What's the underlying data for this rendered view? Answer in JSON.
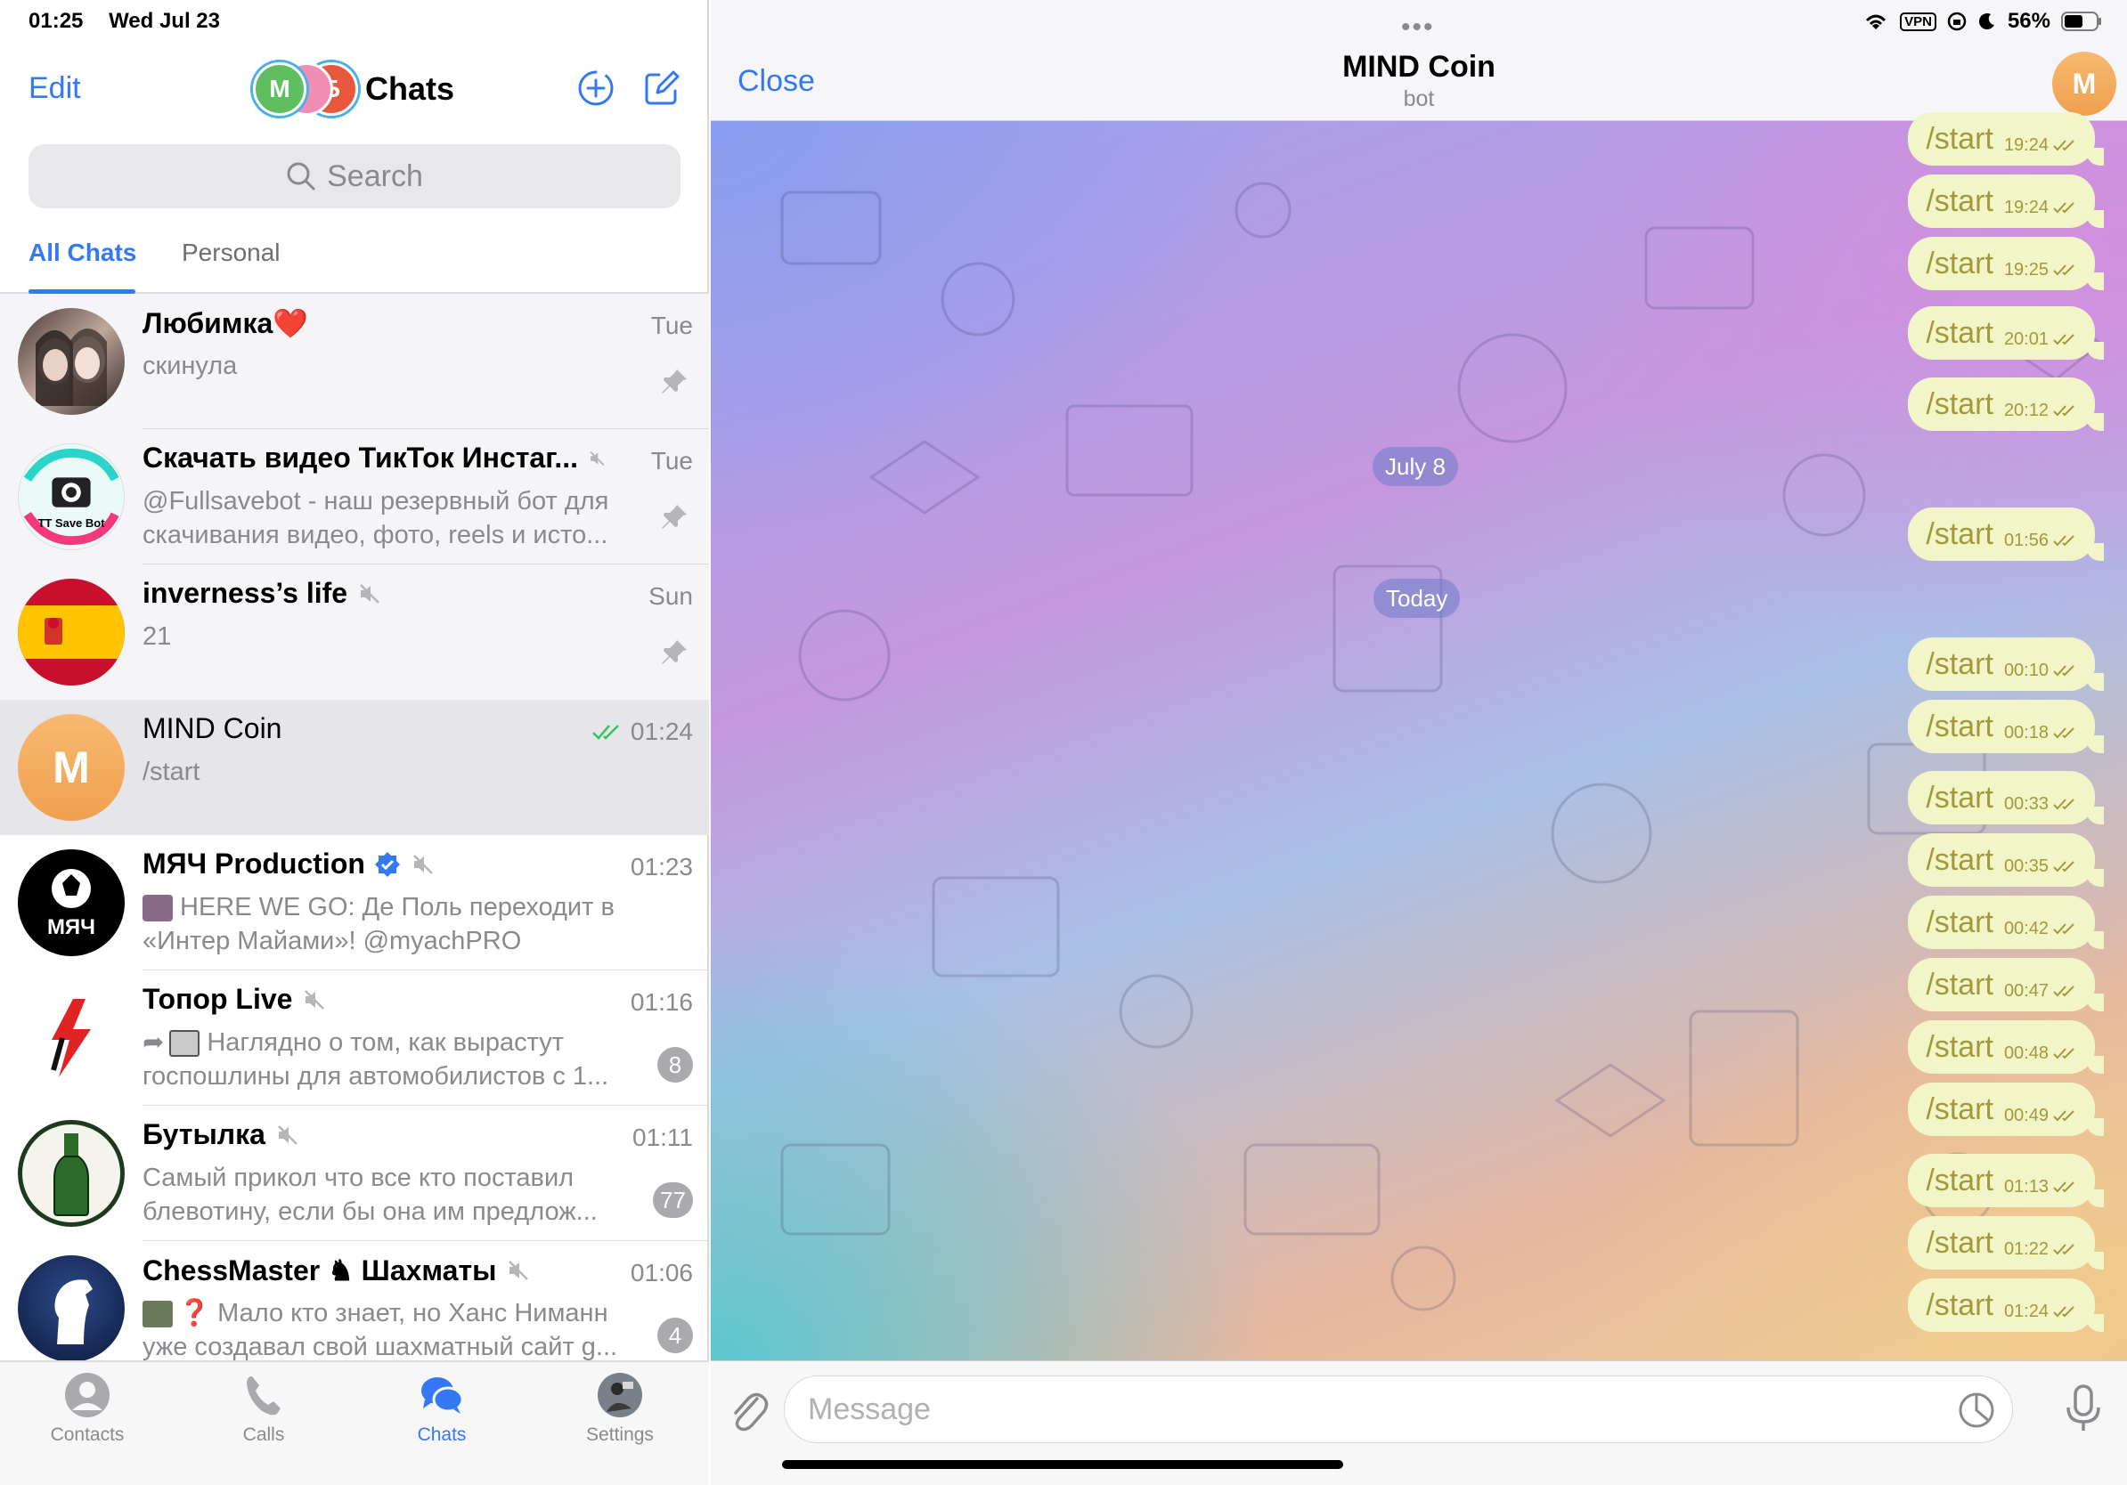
{
  "status_bar": {
    "time": "01:25",
    "date": "Wed Jul 23",
    "vpn": "VPN",
    "battery": "56%"
  },
  "left": {
    "edit": "Edit",
    "title": "Chats",
    "folder_avatars": [
      "М",
      "",
      "Б"
    ],
    "search_placeholder": "Search",
    "tabs": [
      "All Chats",
      "Personal"
    ]
  },
  "chats": [
    {
      "name": "Любимка❤️",
      "time": "Tue",
      "preview": "скинула",
      "pinned": true,
      "muted": false
    },
    {
      "name": "Скачать видео ТикТок Инстаг...",
      "time": "Tue",
      "preview": "@Fullsavebot - наш резервный бот для скачивания видео, фото, reels и исто...",
      "pinned": true,
      "muted": true,
      "avatar_label": "TT Save Bot"
    },
    {
      "name": "inverness’s life",
      "time": "Sun",
      "preview": "21",
      "pinned": true,
      "muted": true
    },
    {
      "name": "MIND Coin",
      "time": "01:24",
      "preview": "/start",
      "avatar_letter": "M",
      "read": true
    },
    {
      "name": "МЯЧ Production",
      "time": "01:23",
      "preview": "HERE WE GO: Де Поль переходит в «Интер Майами»! @myachPRO",
      "verified": true,
      "muted": true,
      "avatar_label": "МЯЧ"
    },
    {
      "name": "Топор Live",
      "time": "01:16",
      "preview": "Наглядно о том, как вырастут госпошлины для автомобилистов с 1...",
      "muted": true,
      "badge": "8"
    },
    {
      "name": "Бутылка",
      "time": "01:11",
      "preview": "Самый прикол что все кто поставил блевотину, если бы она им предлож...",
      "muted": true,
      "badge": "77"
    },
    {
      "name": "ChessMaster ♞ Шахматы",
      "time": "01:06",
      "preview": "Мало кто знает, но Ханс Ниманн уже создавал свой шахматный сайт g...",
      "muted": true,
      "badge": "4"
    }
  ],
  "tabbar": [
    {
      "label": "Contacts",
      "icon": "person-circle-icon"
    },
    {
      "label": "Calls",
      "icon": "phone-icon"
    },
    {
      "label": "Chats",
      "icon": "chat-bubbles-icon",
      "active": true
    },
    {
      "label": "Settings",
      "icon": "profile-photo-icon"
    }
  ],
  "chat": {
    "close": "Close",
    "title": "MIND Coin",
    "subtitle": "bot",
    "avatar_letter": "M",
    "input_placeholder": "Message",
    "dates": [
      "July 8",
      "Today"
    ],
    "messages": [
      {
        "text": "/start",
        "time": "19:24"
      },
      {
        "text": "/start",
        "time": "19:24"
      },
      {
        "text": "/start",
        "time": "19:25"
      },
      {
        "text": "/start",
        "time": "20:01"
      },
      {
        "text": "/start",
        "time": "20:12"
      },
      {
        "text": "/start",
        "time": "01:56"
      },
      {
        "text": "/start",
        "time": "00:10"
      },
      {
        "text": "/start",
        "time": "00:18"
      },
      {
        "text": "/start",
        "time": "00:33"
      },
      {
        "text": "/start",
        "time": "00:35"
      },
      {
        "text": "/start",
        "time": "00:42"
      },
      {
        "text": "/start",
        "time": "00:47"
      },
      {
        "text": "/start",
        "time": "00:48"
      },
      {
        "text": "/start",
        "time": "00:49"
      },
      {
        "text": "/start",
        "time": "01:13"
      },
      {
        "text": "/start",
        "time": "01:22"
      },
      {
        "text": "/start",
        "time": "01:24"
      }
    ]
  },
  "colors": {
    "accent": "#3478f6",
    "bubble": "#f1f5c8",
    "bubble_text": "#a29a3a",
    "read_check": "#34c759"
  }
}
